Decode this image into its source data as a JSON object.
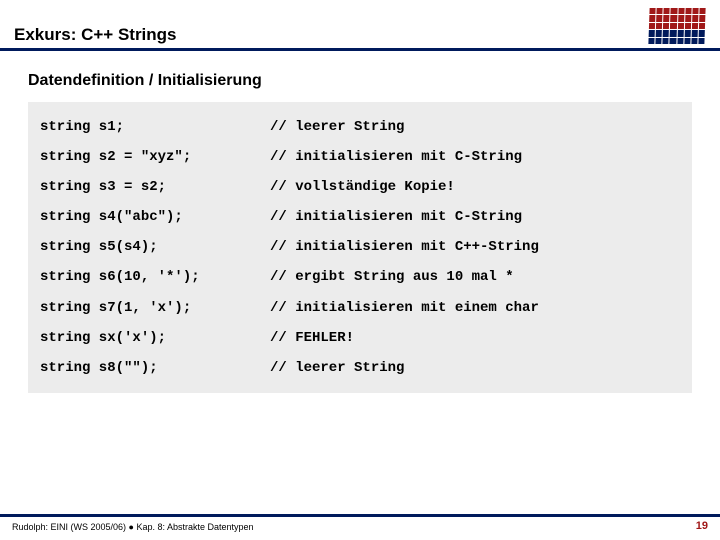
{
  "header": {
    "title": "Exkurs: C++ Strings"
  },
  "subtitle": "Datendefinition / Initialisierung",
  "rows": [
    {
      "code": "string s1;",
      "comment": "// leerer String"
    },
    {
      "code": "string s2 = \"xyz\";",
      "comment": "// initialisieren mit C-String"
    },
    {
      "code": "string s3 = s2;",
      "comment": "// vollständige Kopie!"
    },
    {
      "code": "string s4(\"abc\");",
      "comment": "// initialisieren mit C-String"
    },
    {
      "code": "string s5(s4);",
      "comment": "// initialisieren mit C++-String"
    },
    {
      "code": "string s6(10, '*');",
      "comment": "// ergibt String aus 10 mal *"
    },
    {
      "code": "string s7(1, 'x');",
      "comment": "// initialisieren mit einem char"
    },
    {
      "code": "string sx('x');",
      "comment": "// FEHLER!"
    },
    {
      "code": "string s8(\"\");",
      "comment": "// leerer String"
    }
  ],
  "footer": {
    "left": "Rudolph: EINI (WS 2005/06) ● Kap. 8: Abstrakte Datentypen",
    "page": "19"
  }
}
